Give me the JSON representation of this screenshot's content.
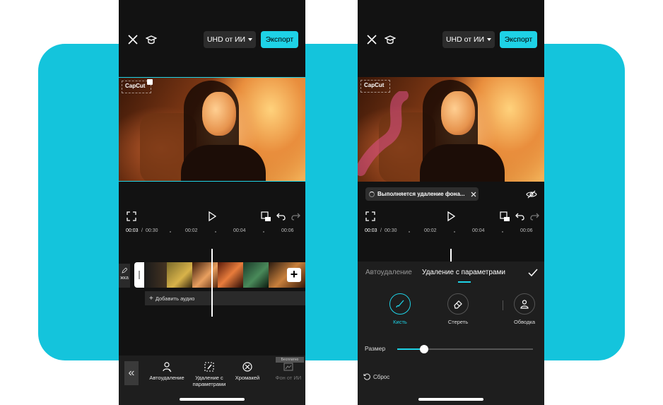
{
  "colors": {
    "accent": "#1ed2e6",
    "band": "#14c4dc",
    "phone_bg": "#121212"
  },
  "left_phone": {
    "header": {
      "close_icon": "close-icon",
      "tutorial_icon": "graduation-cap-icon",
      "quality_label": "UHD от ИИ",
      "export_label": "Экспорт"
    },
    "video": {
      "watermark": "CapCut"
    },
    "timecode": {
      "current": "00:03",
      "separator": "/",
      "total": "00:30",
      "marks": [
        "00:02",
        "00:04",
        "00:06"
      ]
    },
    "timeline": {
      "cover_label": "Обложка",
      "cover_visible": "жка",
      "add_audio_label": "Добавить аудио"
    },
    "toolbar": {
      "collapse_label": "«",
      "tools": [
        {
          "label": "Автоудаление",
          "icon": "person-scan-icon",
          "enabled": true
        },
        {
          "label": "Удаление с параметрами",
          "icon": "brush-frame-icon",
          "enabled": true
        },
        {
          "label": "Хромакей",
          "icon": "chroma-key-icon",
          "enabled": true
        },
        {
          "label": "Фон от ИИ",
          "icon": "ai-background-icon",
          "enabled": false
        }
      ],
      "beta_label": "Бесплатно"
    }
  },
  "right_phone": {
    "header": {
      "quality_label": "UHD от ИИ",
      "export_label": "Экспорт"
    },
    "progress_text": "Выполняется удаление фона...",
    "timecode": {
      "current": "00:03",
      "separator": "/",
      "total": "00:30",
      "marks": [
        "00:02",
        "00:04",
        "00:06"
      ]
    },
    "panel": {
      "tab_auto": "Автоудаление",
      "tab_params": "Удаление с параметрами",
      "tools": [
        {
          "label": "Кисть",
          "icon": "brush-icon",
          "active": true
        },
        {
          "label": "Стереть",
          "icon": "eraser-icon",
          "active": false
        },
        {
          "label": "Обводка",
          "icon": "person-outline-icon",
          "active": false
        }
      ],
      "size_label": "Размер",
      "size_value": 0.2,
      "reset_label": "Сброс"
    }
  }
}
